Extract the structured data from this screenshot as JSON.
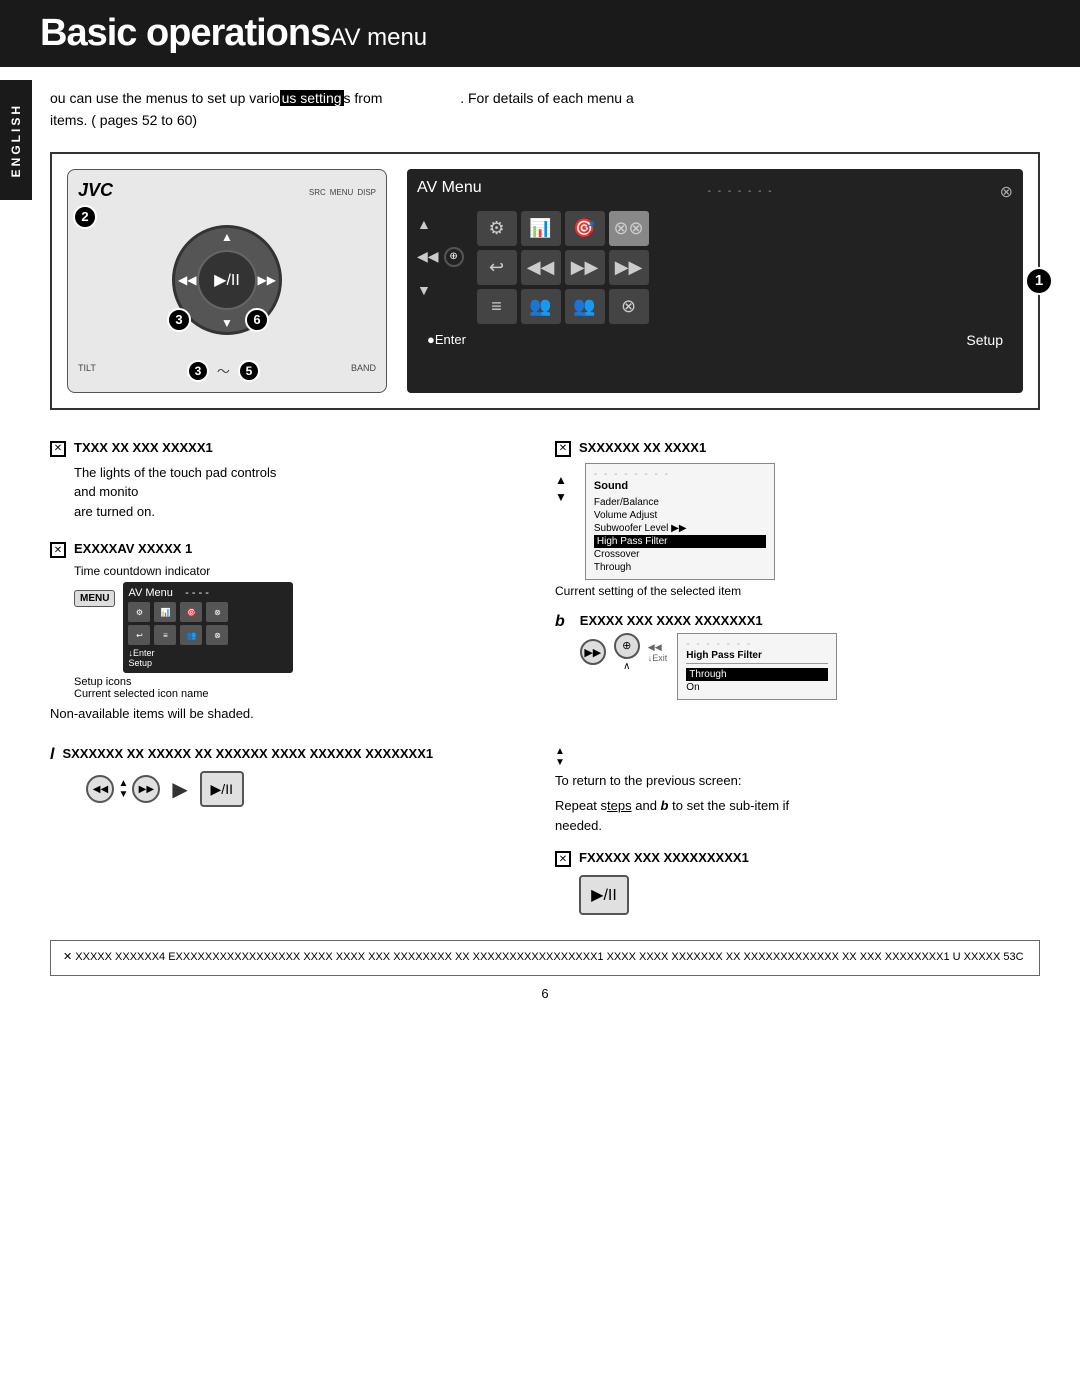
{
  "header": {
    "title_bold": "Basic operations",
    "title_normal": "AV menu"
  },
  "sidebar": {
    "language": "ENGLISH"
  },
  "intro": {
    "text1": "ou can use the menus to set up vario",
    "highlight": "us setting",
    "text2": "s from",
    "text3": ". For details of each menu a",
    "text4": "items.  (  pages 52 to 60)"
  },
  "device": {
    "badge1": "1",
    "badge2": "2",
    "badge3a": "3",
    "badge6": "6",
    "badge3b": "3",
    "tilde": "～",
    "badge5": "5",
    "jvc_logo": "JVC",
    "av_menu_label": "AV Menu",
    "enter_label": "●Enter",
    "setup_label": "Setup",
    "dotted": "- - - - - - - -",
    "src_label": "SRC",
    "menu_label": "MENU",
    "disp_label": "DISP",
    "tilt_label": "TILT",
    "band_label": "BAND"
  },
  "steps": {
    "step_a_check": "✕",
    "step_a_title": "TXXX XX XXX XXXXX1",
    "step_a_desc": "The lights of the touch pad controls and monito\nare turned on.",
    "step_b_check": "✕",
    "step_b_title": "SXXXXXX XX XXXX1",
    "step_c_check": "✕",
    "step_c_title": "EXXXXAV XXXXX 1",
    "time_countdown": "Time countdown indicator",
    "setup_icons": "Setup icons",
    "current_icon_name": "Current selected icon name",
    "non_available": "Non-available items will be shaded.",
    "current_setting": "Current setting of the selected item",
    "step_b2_check": "b",
    "step_b2_title": "EXXXX XXX XXXX XXXXXXX1",
    "to_return": "To return to the previous screen:",
    "step_i_check": "l",
    "step_i_title": "SXXXXXX XX XXXXX XX XXXXXX XXXX XXXXXX XXXXXXX1",
    "repeat_text": "Repeat s",
    "steps_and_b": "teps",
    "repeat_b": "b",
    "repeat_desc": " to set the sub-item if\nneeded.",
    "step_f_check": "✕",
    "step_f_title": "FXXXXX XXX XXXXXXXXX1"
  },
  "sound_menu": {
    "title": "Sound",
    "items": [
      {
        "label": "Fader/Balance",
        "active": false
      },
      {
        "label": "Volume Adjust",
        "active": false
      },
      {
        "label": "Subwoofer Level ▶▶",
        "active": false
      },
      {
        "label": "High Pass Filter",
        "active": true,
        "highlighted": true
      },
      {
        "label": "Crossover",
        "active": false
      },
      {
        "label": "Through",
        "active": false
      }
    ],
    "dotted": "- - - - - - - -"
  },
  "hpf_menu": {
    "title": "High Pass Filter",
    "items": [
      {
        "label": "Through",
        "selected": true
      },
      {
        "label": "On",
        "selected": false
      }
    ],
    "dotted": "- - - - - - - -",
    "exit_label": "Exit"
  },
  "footer": {
    "note": "✕ XXXXX XXXXXX4 EXXXXXXXXXXXXXXXXX XXXX XXXX XXX XXXXXXXX XX XXXXXXXXXXXXXXXXX1 XXXX XXXX XXXXXXX XX\nXXXXXXXXXXXXX XX XXX XXXXXXXX1 U XXXXX 53C",
    "page_number": "6"
  }
}
